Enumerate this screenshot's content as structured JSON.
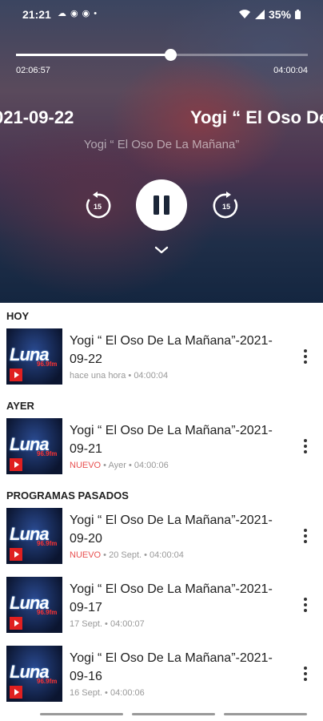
{
  "status_bar": {
    "time": "21:21",
    "icons": [
      "cloud-icon",
      "app-icon",
      "app-icon",
      "dot-icon"
    ],
    "battery": "35%"
  },
  "player": {
    "elapsed": "02:06:57",
    "total": "04:00:04",
    "progress": 0.53,
    "marquee_left": "021-09-22",
    "marquee_right": "Yogi “ El Oso De",
    "subtitle": "Yogi “ El Oso De La Mañana”",
    "skip_back_label": "15",
    "skip_forward_label": "15"
  },
  "sections": {
    "today": "HOY",
    "yesterday": "AYER",
    "past": "PROGRAMAS PASADOS"
  },
  "episodes": [
    {
      "title": "Yogi “ El Oso De La Mañana”-2021-09-22",
      "new": "",
      "date": "hace una hora",
      "duration": "04:00:04"
    },
    {
      "title": "Yogi “ El Oso De La Mañana”-2021-09-21",
      "new": "NUEVO",
      "date": "Ayer",
      "duration": "04:00:06"
    },
    {
      "title": "Yogi “ El Oso De La Mañana”-2021-09-20",
      "new": "NUEVO",
      "date": "20 Sept.",
      "duration": "04:00:04"
    },
    {
      "title": "Yogi “ El Oso De La Mañana”-2021-09-17",
      "new": "",
      "date": "17 Sept.",
      "duration": "04:00:07"
    },
    {
      "title": "Yogi “ El Oso De La Mañana”-2021-09-16",
      "new": "",
      "date": "16 Sept.",
      "duration": "04:00:06"
    }
  ],
  "thumbnail": {
    "logo": "Luna",
    "sub": "96.9fm"
  },
  "colors": {
    "accent_new": "#e85050",
    "play_badge": "#e02020"
  }
}
